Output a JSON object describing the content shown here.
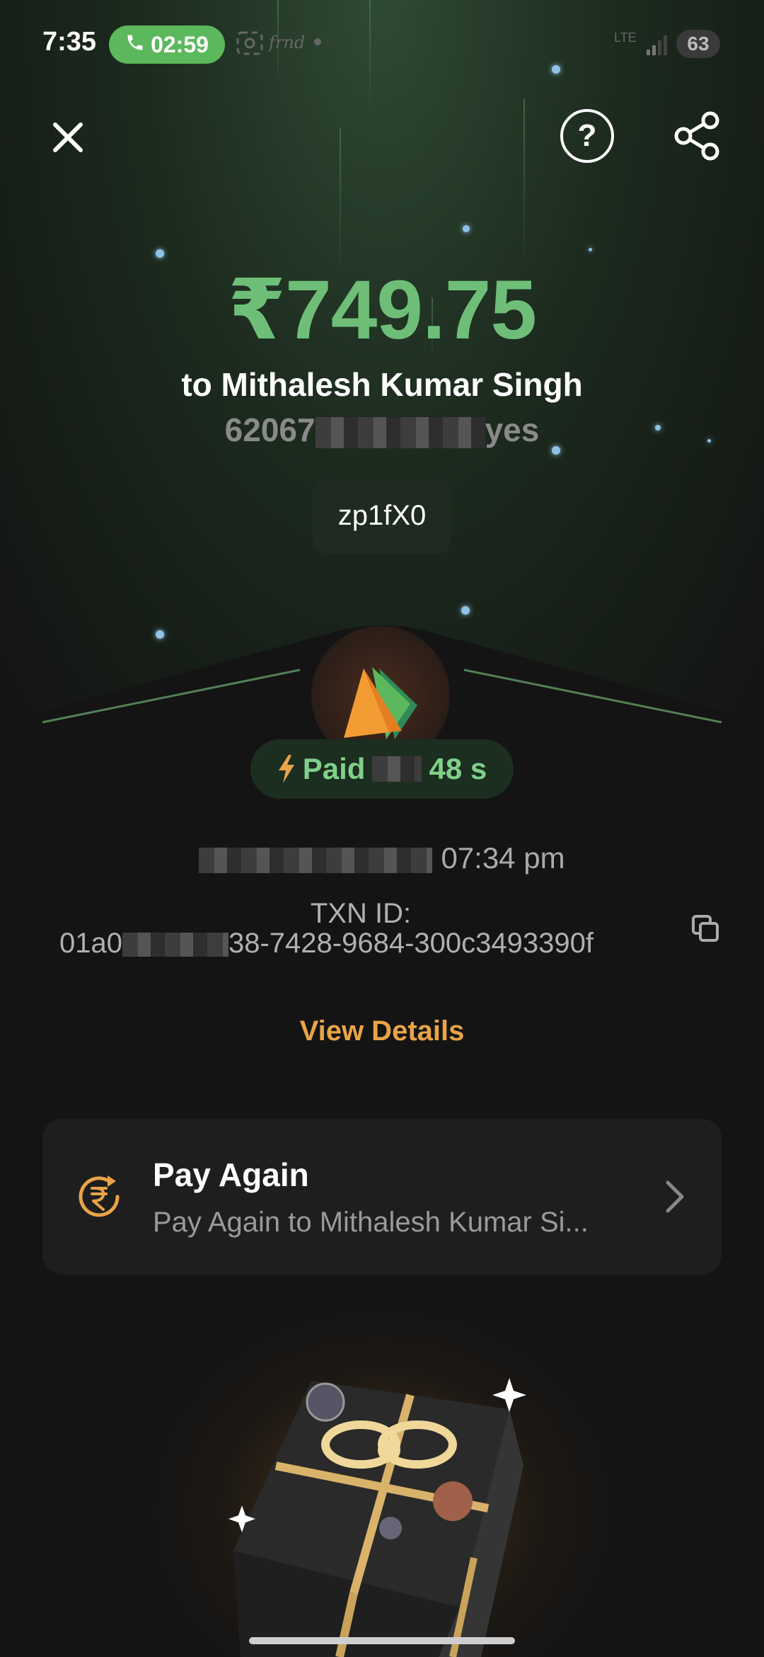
{
  "status_bar": {
    "time": "7:35",
    "call_timer": "02:59",
    "frnd_label": "frnd",
    "network": "LTE",
    "battery": "63"
  },
  "header": {
    "close_icon": "close-icon",
    "help_icon": "help-icon",
    "share_icon": "share-icon"
  },
  "payment": {
    "amount": "₹749.75",
    "payee": "to Mithalesh Kumar Singh",
    "upi_prefix": "62067",
    "upi_suffix": "yes",
    "note": "zp1fX0",
    "status_prefix": "Paid",
    "status_suffix": "48 s",
    "time": "07:34 pm",
    "txn_label": "TXN ID:",
    "txn_prefix": "01a0",
    "txn_suffix": "38-7428-9684-300c3493390f",
    "view_details": "View Details"
  },
  "pay_again": {
    "title": "Pay Again",
    "subtitle": "Pay Again to Mithalesh Kumar Si..."
  },
  "colors": {
    "amount_green": "#6fbe78",
    "accent_orange": "#e9a448",
    "call_green": "#5cb85c"
  }
}
